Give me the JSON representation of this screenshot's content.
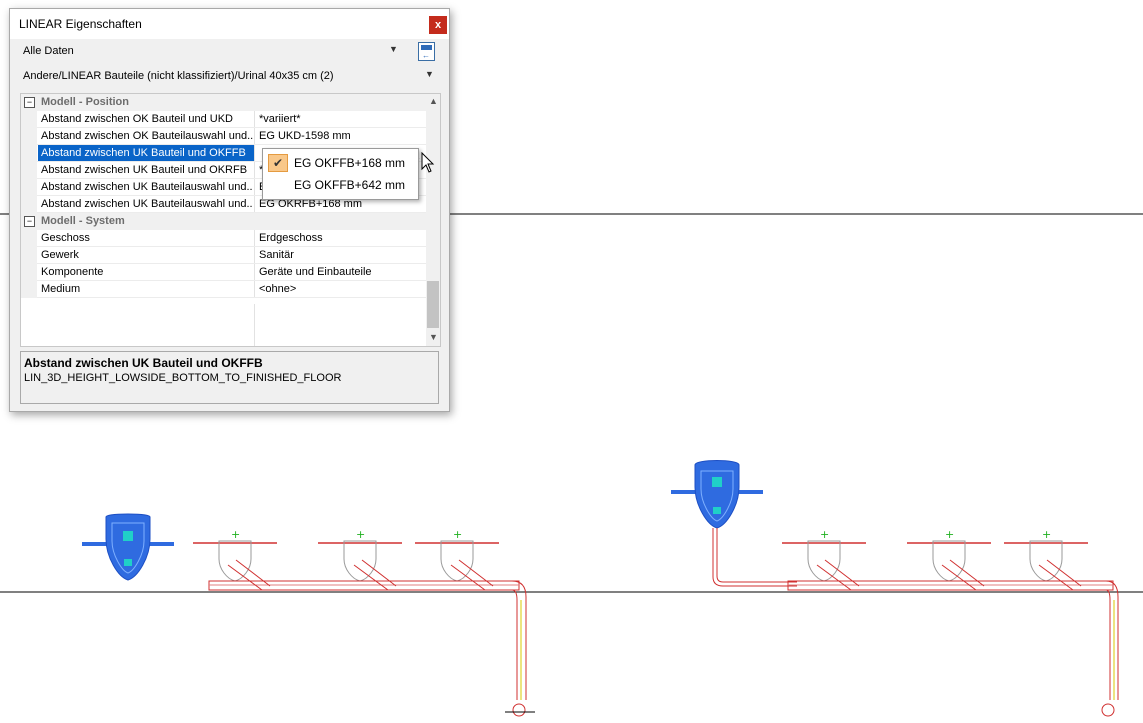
{
  "window": {
    "title": "LINEAR Eigenschaften",
    "close_label": "x",
    "filter_selection": "Alle Daten",
    "object_path": "Andere/LINEAR Bauteile (nicht klassifiziert)/Urinal 40x35 cm (2)"
  },
  "grid": {
    "categories": [
      {
        "label": "Modell - Position",
        "toggle": "−",
        "rows": [
          {
            "name": "Abstand zwischen OK Bauteil und UKD",
            "value": "*variiert*"
          },
          {
            "name": "Abstand zwischen OK Bauteilauswahl und...",
            "value": "EG UKD-1598 mm"
          },
          {
            "name": "Abstand zwischen UK Bauteil und OKFFB",
            "value": ""
          },
          {
            "name": "Abstand zwischen UK Bauteil und OKRFB",
            "value": "*v"
          },
          {
            "name": "Abstand zwischen UK Bauteilauswahl und...",
            "value": "E"
          },
          {
            "name": "Abstand zwischen UK Bauteilauswahl und...",
            "value": "EG OKRFB+168 mm"
          }
        ]
      },
      {
        "label": "Modell - System",
        "toggle": "−",
        "rows": [
          {
            "name": "Geschoss",
            "value": "Erdgeschoss"
          },
          {
            "name": "Gewerk",
            "value": "Sanitär"
          },
          {
            "name": "Komponente",
            "value": "Geräte und Einbauteile"
          },
          {
            "name": "Medium",
            "value": "<ohne>"
          }
        ]
      }
    ]
  },
  "dropdown": {
    "options": [
      {
        "label": "EG OKFFB+168 mm",
        "checked": true
      },
      {
        "label": "EG OKFFB+642 mm",
        "checked": false
      }
    ]
  },
  "description": {
    "title": "Abstand zwischen UK Bauteil und OKFFB",
    "text": "LIN_3D_HEIGHT_LOWSIDE_BOTTOM_TO_FINISHED_FLOOR"
  },
  "colors": {
    "accent_selection": "#0a64c8",
    "close_button": "#c42b1c",
    "urinal_blue": "#2f6be0",
    "pipe_red": "#d03030",
    "pipe_yellow": "#d8c800",
    "marker_green": "#20b020"
  }
}
